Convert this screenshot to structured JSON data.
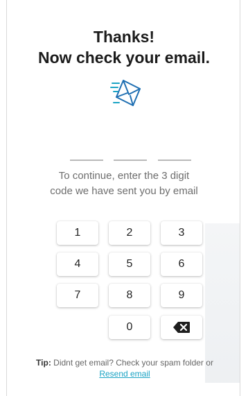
{
  "header": {
    "title_line1": "Thanks!",
    "title_line2": "Now check your email."
  },
  "icons": {
    "mail": "send-mail-icon",
    "backspace": "backspace-icon"
  },
  "colors": {
    "accent": "#1aa3c4",
    "icon_blue": "#1f6fb2"
  },
  "instructions": "To continue, enter the 3 digit code we have sent you by email",
  "keypad": {
    "k1": "1",
    "k2": "2",
    "k3": "3",
    "k4": "4",
    "k5": "5",
    "k6": "6",
    "k7": "7",
    "k8": "8",
    "k9": "9",
    "k0": "0"
  },
  "tip": {
    "label": "Tip:",
    "text": " Didnt get email? Check your spam folder or ",
    "link": "Resend email"
  }
}
